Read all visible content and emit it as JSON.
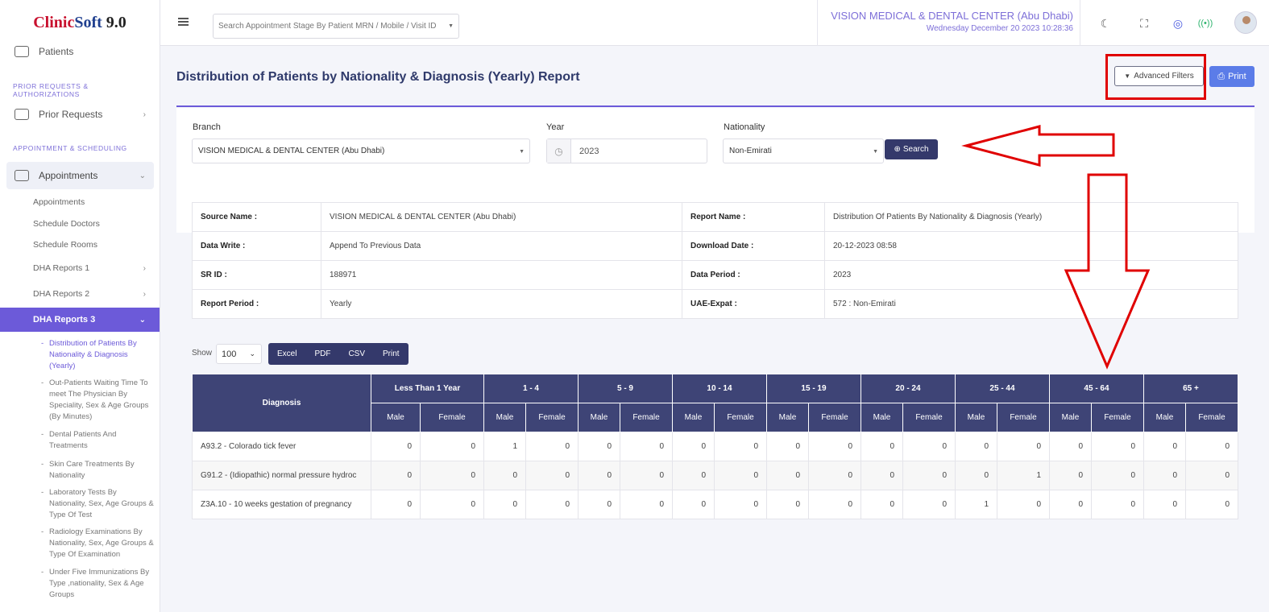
{
  "logo": {
    "part1": "Clinic",
    "part2": "Soft",
    "version": "9.0"
  },
  "sidebar": {
    "patients": "Patients",
    "section_prior": "PRIOR REQUESTS & AUTHORIZATIONS",
    "prior_requests": "Prior Requests",
    "section_appointment": "APPOINTMENT & SCHEDULING",
    "appointments_group": "Appointments",
    "subs": [
      "Appointments",
      "Schedule Doctors",
      "Schedule Rooms"
    ],
    "dha1": "DHA Reports 1",
    "dha2": "DHA Reports 2",
    "dha3": "DHA Reports 3",
    "reports": [
      [
        "Distribution of Patients By",
        "Nationality & Diagnosis",
        "(Yearly)"
      ],
      [
        "Out-Patients Waiting Time To",
        "meet The Physician By",
        "Speciality, Sex & Age Groups",
        "(By Minutes)"
      ],
      [
        "Dental Patients And",
        "Treatments"
      ],
      [
        "Skin Care Treatments By",
        "Nationality"
      ],
      [
        "Laboratory Tests By",
        "Nationality, Sex, Age Groups &",
        "Type Of Test"
      ],
      [
        "Radiology Examinations By",
        "Nationality, Sex, Age Groups &",
        "Type Of Examination"
      ],
      [
        "Under Five Immunizations By",
        "Type ,nationality, Sex & Age",
        "Groups"
      ]
    ]
  },
  "header": {
    "search_placeholder": "Search Appointment Stage By Patient MRN / Mobile / Visit ID",
    "center_name": "VISION MEDICAL & DENTAL CENTER (Abu Dhabi)",
    "datetime": "Wednesday December 20 2023 10:28:36"
  },
  "page": {
    "title": "Distribution of Patients by Nationality & Diagnosis (Yearly) Report",
    "advanced_filters": "Advanced Filters",
    "print": "Print"
  },
  "filters": {
    "branch_label": "Branch",
    "branch_value": "VISION MEDICAL & DENTAL CENTER (Abu Dhabi)",
    "year_label": "Year",
    "year_value": "2023",
    "nationality_label": "Nationality",
    "nationality_value": "Non-Emirati",
    "search_label": "Search"
  },
  "info": {
    "source_name_label": "Source Name :",
    "source_name": "VISION MEDICAL & DENTAL CENTER (Abu Dhabi)",
    "report_name_label": "Report Name :",
    "report_name": "Distribution Of Patients By Nationality & Diagnosis (Yearly)",
    "data_write_label": "Data Write :",
    "data_write": "Append To Previous Data",
    "download_date_label": "Download Date :",
    "download_date": "20-12-2023 08:58",
    "sr_id_label": "SR ID :",
    "sr_id": "188971",
    "data_period_label": "Data Period :",
    "data_period": "2023",
    "report_period_label": "Report Period :",
    "report_period": "Yearly",
    "uae_expat_label": "UAE-Expat :",
    "uae_expat": "572 : Non-Emirati"
  },
  "export": {
    "show_label": "Show",
    "show_value": "100",
    "buttons": [
      "Excel",
      "PDF",
      "CSV",
      "Print"
    ]
  },
  "table": {
    "diagnosis_header": "Diagnosis",
    "age_groups": [
      "Less Than 1 Year",
      "1 - 4",
      "5 - 9",
      "10 - 14",
      "15 - 19",
      "20 - 24",
      "25 - 44",
      "45 - 64",
      "65 +"
    ],
    "male": "Male",
    "female": "Female",
    "rows": [
      {
        "diagnosis": "A93.2 - Colorado tick fever",
        "values": [
          "0",
          "0",
          "1",
          "0",
          "0",
          "0",
          "0",
          "0",
          "0",
          "0",
          "0",
          "0",
          "0",
          "0",
          "0",
          "0",
          "0",
          "0"
        ]
      },
      {
        "diagnosis": "G91.2 - (Idiopathic) normal pressure hydroc",
        "values": [
          "0",
          "0",
          "0",
          "0",
          "0",
          "0",
          "0",
          "0",
          "0",
          "0",
          "0",
          "0",
          "0",
          "1",
          "0",
          "0",
          "0",
          "0"
        ]
      },
      {
        "diagnosis": "Z3A.10 - 10 weeks gestation of pregnancy",
        "values": [
          "0",
          "0",
          "0",
          "0",
          "0",
          "0",
          "0",
          "0",
          "0",
          "0",
          "0",
          "0",
          "1",
          "0",
          "0",
          "0",
          "0",
          "0"
        ]
      }
    ]
  },
  "colors": {
    "accent": "#6c5ad9",
    "navy": "#3e4476",
    "annotation": "#e00000"
  }
}
